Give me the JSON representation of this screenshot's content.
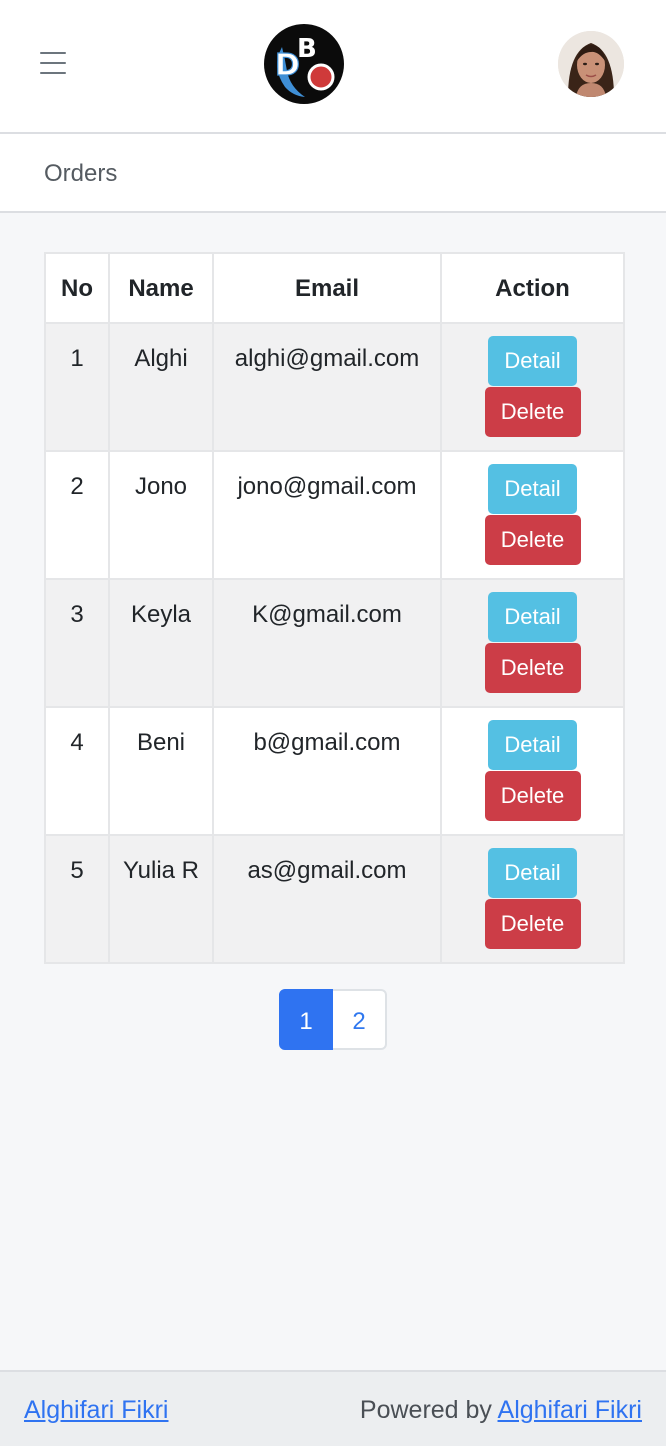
{
  "header": {
    "menu_icon": "hamburger-icon",
    "logo_letters": "DBO",
    "avatar_icon": "user-avatar"
  },
  "page": {
    "title": "Orders"
  },
  "table": {
    "columns": [
      "No",
      "Name",
      "Email",
      "Action"
    ],
    "rows": [
      {
        "no": "1",
        "name": "Alghi",
        "email": "alghi@gmail.com"
      },
      {
        "no": "2",
        "name": "Jono",
        "email": "jono@gmail.com"
      },
      {
        "no": "3",
        "name": "Keyla",
        "email": "K@gmail.com"
      },
      {
        "no": "4",
        "name": "Beni",
        "email": "b@gmail.com"
      },
      {
        "no": "5",
        "name": "Yulia R",
        "email": "as@gmail.com"
      }
    ],
    "detail_label": "Detail",
    "delete_label": "Delete"
  },
  "pagination": {
    "pages": [
      "1",
      "2"
    ],
    "current": "1"
  },
  "footer": {
    "left_link": "Alghifari Fikri",
    "powered_prefix": "Powered by",
    "right_link": "Alghifari Fikri"
  },
  "colors": {
    "detail": "#54c0e3",
    "delete": "#cc3d47",
    "primary": "#2f73f1"
  }
}
